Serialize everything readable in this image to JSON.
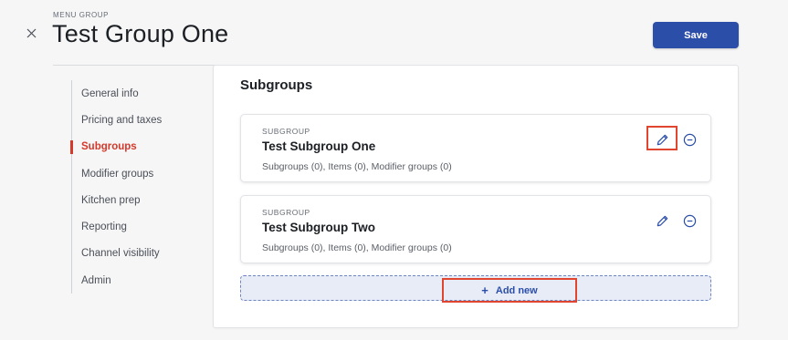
{
  "header": {
    "eyebrow": "MENU GROUP",
    "title": "Test Group One",
    "save_label": "Save",
    "close_icon": "close-icon"
  },
  "sidebar": {
    "items": [
      {
        "label": "General info",
        "active": false
      },
      {
        "label": "Pricing and taxes",
        "active": false
      },
      {
        "label": "Subgroups",
        "active": true
      },
      {
        "label": "Modifier groups",
        "active": false
      },
      {
        "label": "Kitchen prep",
        "active": false
      },
      {
        "label": "Reporting",
        "active": false
      },
      {
        "label": "Channel visibility",
        "active": false
      },
      {
        "label": "Admin",
        "active": false
      }
    ]
  },
  "main": {
    "section_title": "Subgroups",
    "subgroups": [
      {
        "eyebrow": "SUBGROUP",
        "name": "Test Subgroup One",
        "meta": "Subgroups (0), Items (0), Modifier groups (0)",
        "edit_icon": "pencil-icon",
        "remove_icon": "minus-circle-icon"
      },
      {
        "eyebrow": "SUBGROUP",
        "name": "Test Subgroup Two",
        "meta": "Subgroups (0), Items (0), Modifier groups (0)",
        "edit_icon": "pencil-icon",
        "remove_icon": "minus-circle-icon"
      }
    ],
    "add_new_label": "Add new",
    "add_icon": "plus-icon"
  },
  "colors": {
    "accent": "#2b4ea9",
    "active_nav": "#d4392b",
    "highlight": "#e0452f"
  }
}
